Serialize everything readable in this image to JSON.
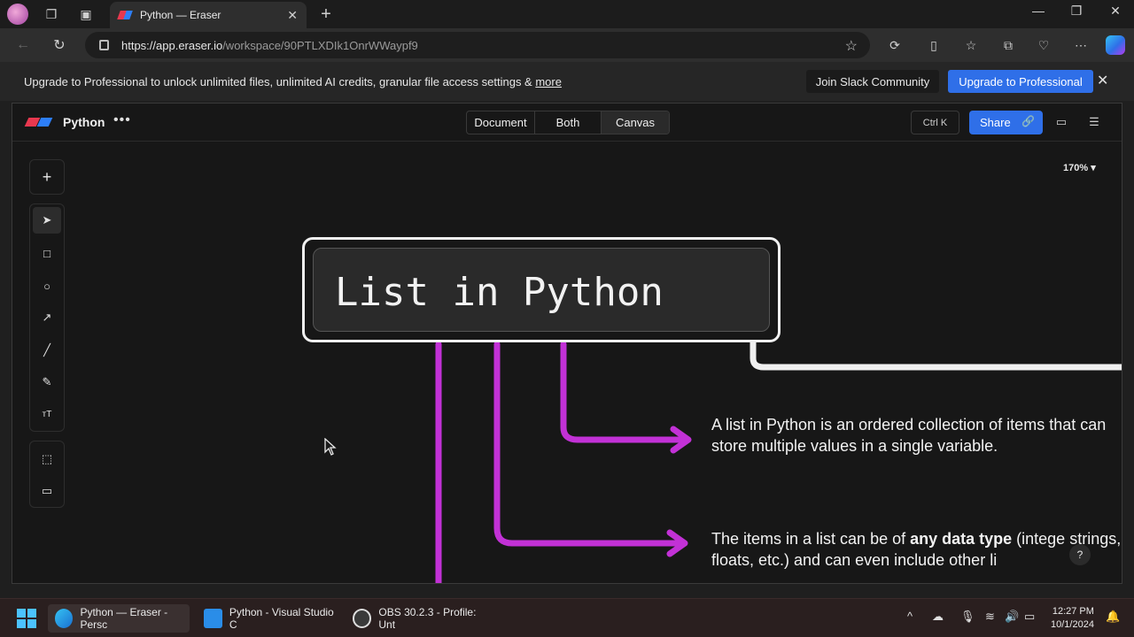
{
  "browser": {
    "tab_title": "Python — Eraser",
    "url_host": "https://app.eraser.io",
    "url_path": "/workspace/90PTLXDIk1OnrWWaypf9"
  },
  "banner": {
    "message": "Upgrade to Professional to unlock unlimited files, unlimited AI credits, granular file access settings & ",
    "more_link": "more",
    "slack_button": "Join Slack Community",
    "upgrade_button": "Upgrade to Professional"
  },
  "app": {
    "file_name": "Python",
    "view_tabs": [
      "Document",
      "Both",
      "Canvas"
    ],
    "active_view": "Canvas",
    "shortcut": "Ctrl K",
    "share_label": "Share",
    "zoom": "170% ▾"
  },
  "canvas": {
    "title": "List in Python",
    "note1": "A list in Python is an ordered collection of items that can store multiple values in a single variable.",
    "note2_prefix": "The items in a list can be of ",
    "note2_bold": "any data type",
    "note2_suffix": " (intege strings, floats, etc.) and can even include other li",
    "arrow_color": "#c231d6"
  },
  "taskbar": {
    "apps": [
      {
        "label": "Python — Eraser - Persc"
      },
      {
        "label": "Python - Visual Studio C"
      },
      {
        "label": "OBS 30.2.3 - Profile: Unt"
      }
    ],
    "time": "12:27 PM",
    "date": "10/1/2024"
  }
}
